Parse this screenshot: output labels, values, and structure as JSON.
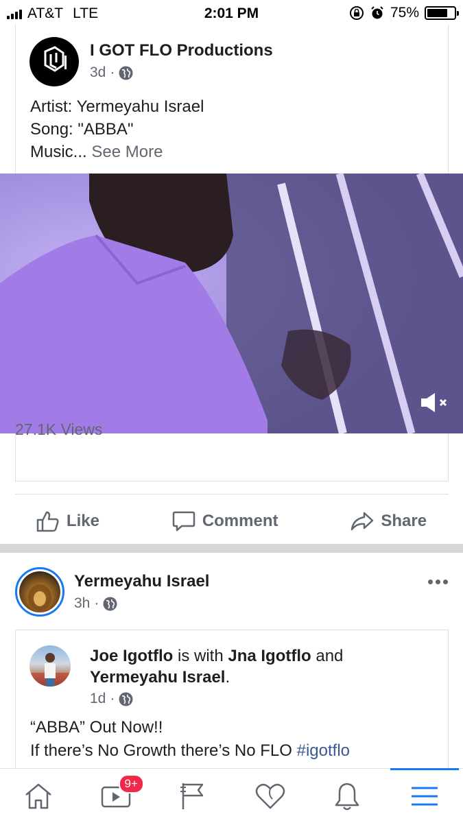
{
  "status_bar": {
    "carrier": "AT&T",
    "network": "LTE",
    "time": "2:01 PM",
    "battery": "75%",
    "battery_level": 0.75
  },
  "post1": {
    "author": "I GOT FLO Productions",
    "time": "3d",
    "dot": "·",
    "lines": [
      "Artist: Yermeyahu Israel",
      "Song: \"ABBA\"",
      "Music..."
    ],
    "see_more": "See More",
    "views": "27.1K Views"
  },
  "actions": {
    "like": "Like",
    "comment": "Comment",
    "share": "Share"
  },
  "post2": {
    "author": "Yermeyahu Israel",
    "time": "3h",
    "dot": "·",
    "shared": {
      "actor": "Joe Igotflo",
      "is_with": "is with",
      "tagged1": "Jna Igotflo",
      "and": "and",
      "tagged2": "Yermeyahu Israel",
      "period": ".",
      "time": "1d",
      "dot": "·",
      "line1": "“ABBA” Out Now!!",
      "line2": "If there’s No Growth there’s No FLO",
      "hashtag": "#igotflo"
    }
  },
  "tab_bar": {
    "video_badge": "9+",
    "icons": [
      "home-icon",
      "video-icon",
      "pages-flag-icon",
      "dating-heart-icon",
      "notifications-bell-icon",
      "menu-icon"
    ]
  },
  "colors": {
    "accent": "#1877f2",
    "badge": "#f02849",
    "meta_text": "#606770",
    "hashtag": "#385898"
  }
}
